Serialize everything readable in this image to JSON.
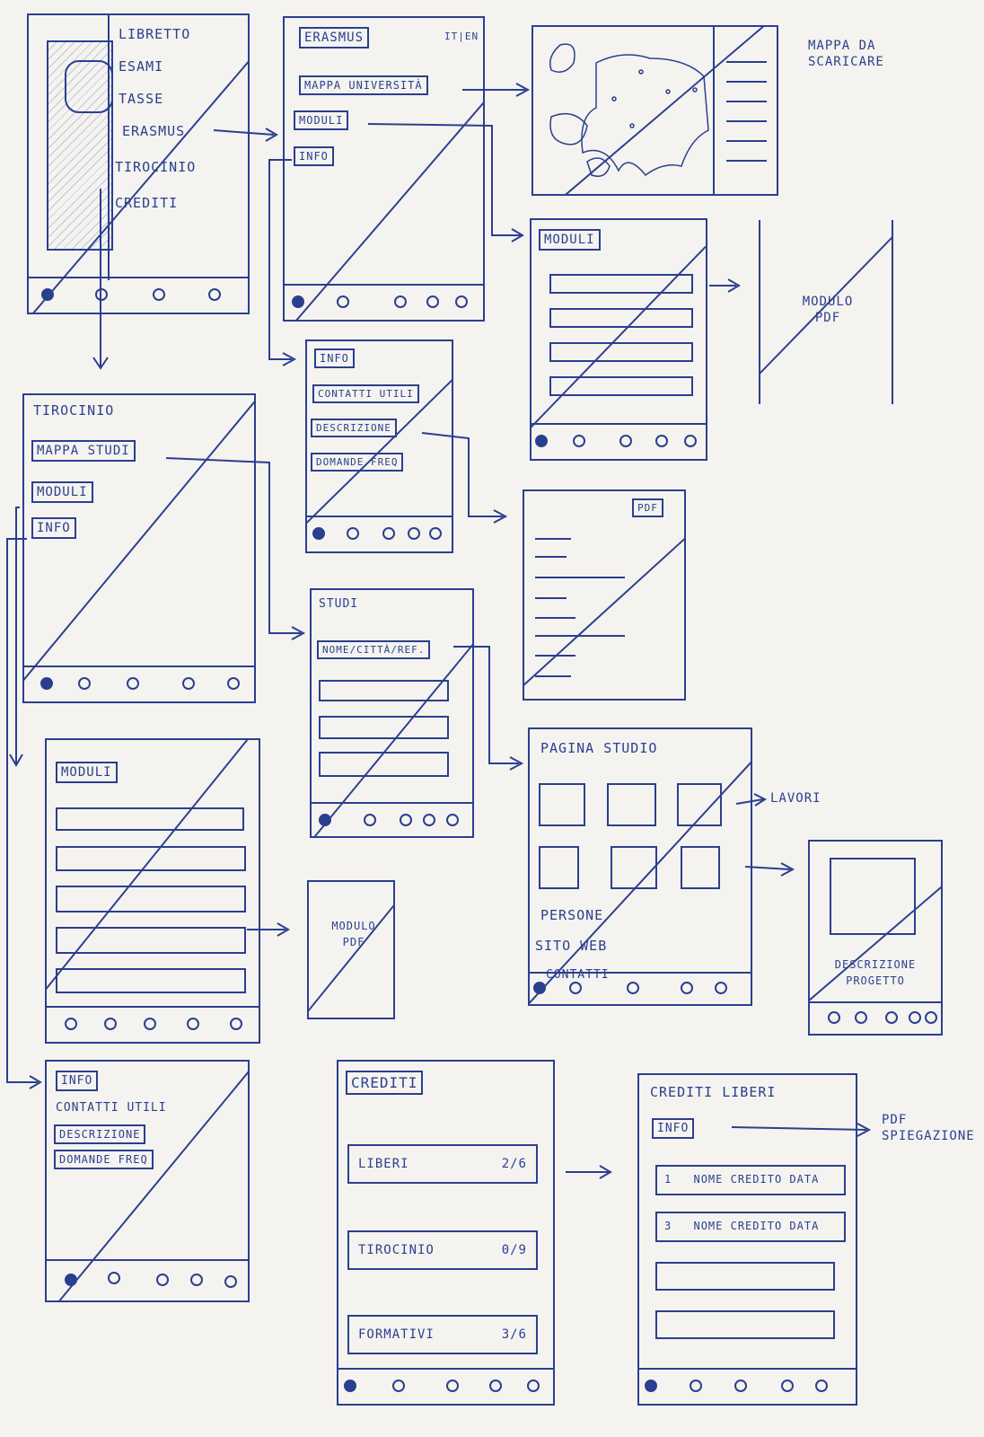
{
  "screen_libretto": {
    "menu": [
      "LIBRETTO",
      "ESAMI",
      "TASSE",
      "ERASMUS",
      "TIROCINIO",
      "CREDITI"
    ]
  },
  "screen_erasmus": {
    "title": "ERASMUS",
    "lang": "IT|EN",
    "buttons": [
      "MAPPA UNIVERSITÀ",
      "MODULI",
      "INFO"
    ]
  },
  "map_note": "MAPPA DA SCARICARE",
  "screen_moduli_erasmus": {
    "title": "MODULI"
  },
  "modulo_pdf_1": "MODULO PDF",
  "screen_info_erasmus": {
    "title": "INFO",
    "buttons": [
      "CONTATTI UTILI",
      "DESCRIZIONE",
      "DOMANDE FREQ"
    ]
  },
  "pdf_doc": {
    "tag": "PDF"
  },
  "screen_tirocinio": {
    "title": "TIROCINIO",
    "buttons": [
      "MAPPA STUDI",
      "MODULI",
      "INFO"
    ]
  },
  "screen_studi": {
    "title": "STUDI",
    "search": "NOME/CITTÀ/REF."
  },
  "screen_pagina_studio": {
    "title": "PAGINA STUDIO",
    "links": [
      "PERSONE",
      "SITO WEB",
      "CONTATTI"
    ]
  },
  "lavori_note": "LAVORI",
  "screen_descrizione_progetto": {
    "text": "DESCRIZIONE PROGETTO"
  },
  "screen_moduli_tirocinio": {
    "title": "MODULI"
  },
  "modulo_pdf_2": "MODULO PDF",
  "screen_info_tirocinio": {
    "title": "INFO",
    "buttons": [
      "CONTATTI UTILI",
      "DESCRIZIONE",
      "DOMANDE FREQ"
    ]
  },
  "screen_crediti": {
    "title": "CREDITI",
    "rows": [
      {
        "label": "LIBERI",
        "count": "2/6"
      },
      {
        "label": "TIROCINIO",
        "count": "0/9"
      },
      {
        "label": "FORMATIVI",
        "count": "3/6"
      }
    ]
  },
  "screen_crediti_liberi": {
    "title": "CREDITI LIBERI",
    "info": "INFO",
    "rows": [
      {
        "num": "1",
        "text": "NOME CREDITO DATA"
      },
      {
        "num": "3",
        "text": "NOME CREDITO DATA"
      }
    ]
  },
  "pdf_note": "PDF SPIEGAZIONE",
  "colors": {
    "ink": "#2b3f8f",
    "paper": "#f4f3ef"
  }
}
